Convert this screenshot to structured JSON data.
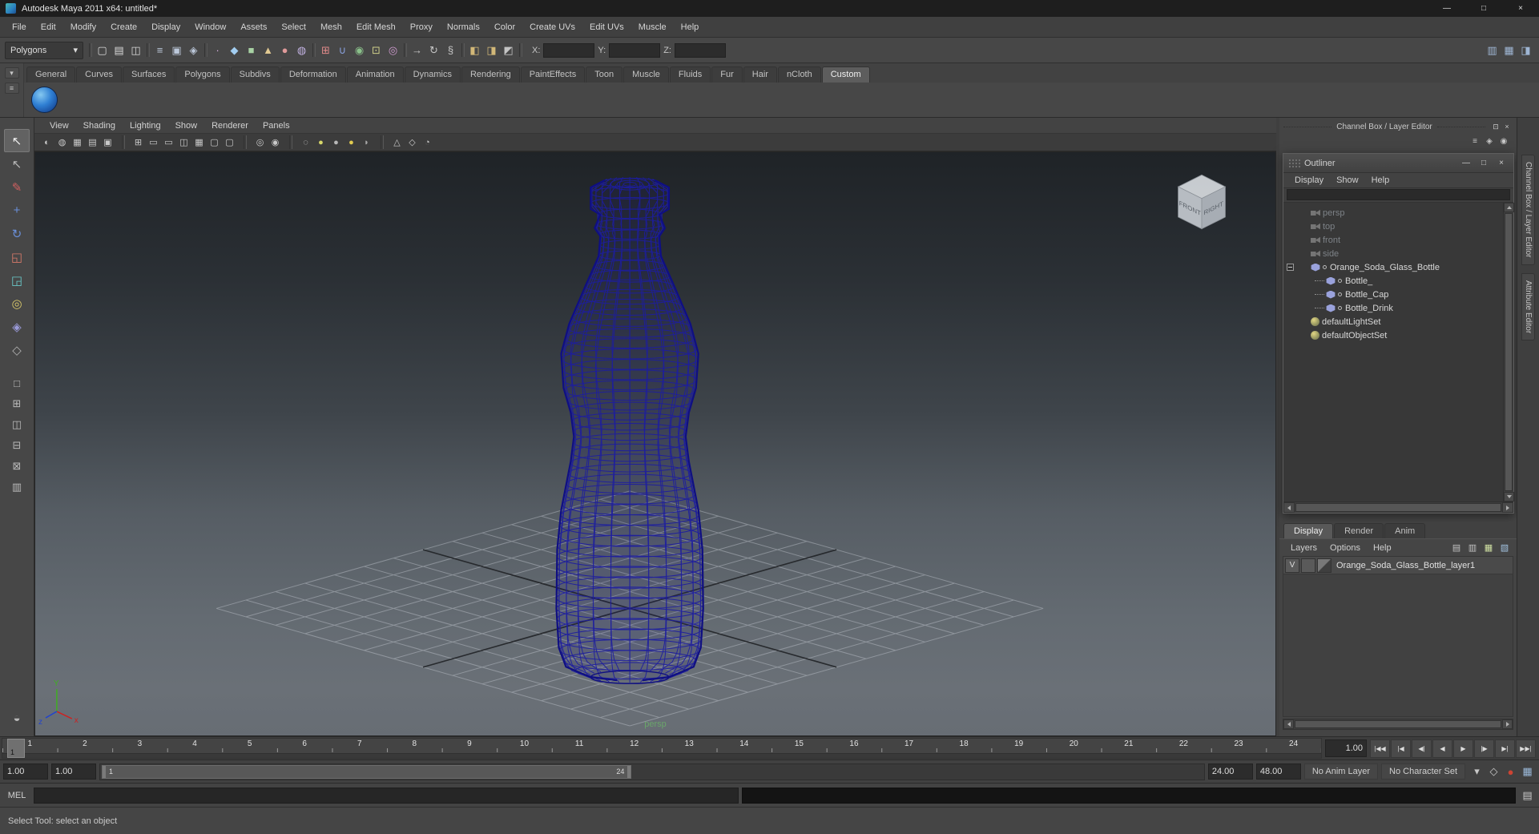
{
  "colors": {
    "wireframe": "#1d1da0",
    "wireframe_dark": "#0f0f82",
    "grid_line": "#c9ced6",
    "grid_axis": "#17191c",
    "axis_x": "#cc2222",
    "axis_y": "#3fae22",
    "axis_z": "#2244cc",
    "camera_label_green": "#6aa66a",
    "autokey_red": "#cc4433",
    "shelf_ball_blue": "#2f7fd3",
    "viewport_top": "#1f2327",
    "viewport_bottom": "#6a7077"
  },
  "window": {
    "title": "Autodesk Maya 2011 x64: untitled*",
    "minimize": "—",
    "maximize": "□",
    "close": "×"
  },
  "menubar": {
    "items": [
      "File",
      "Edit",
      "Modify",
      "Create",
      "Display",
      "Window",
      "Assets",
      "Select",
      "Mesh",
      "Edit Mesh",
      "Proxy",
      "Normals",
      "Color",
      "Create UVs",
      "Edit UVs",
      "Muscle",
      "Help"
    ]
  },
  "statusline": {
    "menuset": "Polygons",
    "dropdown_arrow": "▾",
    "icons": [
      {
        "sep": true
      },
      {
        "name": "new-scene-icon",
        "glyph": "▢",
        "color": "#d8d8d8"
      },
      {
        "name": "open-scene-icon",
        "glyph": "▤",
        "color": "#d8d8d8"
      },
      {
        "name": "save-scene-icon",
        "glyph": "◫",
        "color": "#d8d8d8"
      },
      {
        "sep": true
      },
      {
        "name": "select-hierarchy-icon",
        "glyph": "≡",
        "color": "#bcc8da"
      },
      {
        "name": "select-object-icon",
        "glyph": "▣",
        "color": "#bcc8da"
      },
      {
        "name": "select-component-icon",
        "glyph": "◈",
        "color": "#bcc8da"
      },
      {
        "sep": true
      },
      {
        "name": "mask-points-icon",
        "glyph": "∙",
        "color": "#d8b2e0"
      },
      {
        "name": "mask-curves-icon",
        "glyph": "◆",
        "color": "#a2cdf0"
      },
      {
        "name": "mask-surfaces-icon",
        "glyph": "■",
        "color": "#a8d2a4"
      },
      {
        "name": "mask-deformers-icon",
        "glyph": "▲",
        "color": "#e2ca92"
      },
      {
        "name": "mask-dynamics-icon",
        "glyph": "●",
        "color": "#e09a9a"
      },
      {
        "name": "mask-rendering-icon",
        "glyph": "◍",
        "color": "#c2b2e2"
      },
      {
        "sep": true
      },
      {
        "name": "snap-grid-icon",
        "glyph": "⊞",
        "color": "#e08a8a"
      },
      {
        "name": "snap-curve-icon",
        "glyph": "∪",
        "color": "#8aa2e0"
      },
      {
        "name": "snap-point-icon",
        "glyph": "◉",
        "color": "#8ac08a"
      },
      {
        "name": "snap-view-icon",
        "glyph": "⊡",
        "color": "#cfcf8a"
      },
      {
        "name": "snap-surface-icon",
        "glyph": "◎",
        "color": "#cf9acf"
      },
      {
        "sep": true
      },
      {
        "name": "input-connections-icon",
        "glyph": "→",
        "color": "#c4c4c4"
      },
      {
        "name": "output-connections-icon",
        "glyph": "↻",
        "color": "#c4c4c4"
      },
      {
        "name": "construction-history-icon",
        "glyph": "§",
        "color": "#c4c4c4"
      },
      {
        "sep": true
      },
      {
        "name": "render-current-frame-icon",
        "glyph": "◧",
        "color": "#d2b878"
      },
      {
        "name": "ipr-render-icon",
        "glyph": "◨",
        "color": "#d2b878"
      },
      {
        "name": "render-settings-icon",
        "glyph": "◩",
        "color": "#c4c4c4"
      },
      {
        "sep": true
      }
    ],
    "coord": {
      "x_label": "X:",
      "x_value": "",
      "y_label": "Y:",
      "y_value": "",
      "z_label": "Z:",
      "z_value": ""
    },
    "right_icons": [
      {
        "name": "sidebar-toggle-icon",
        "glyph": "▥"
      },
      {
        "name": "panel-toggle-icon",
        "glyph": "▦"
      },
      {
        "name": "ui-elements-toggle-icon",
        "glyph": "◨"
      }
    ]
  },
  "shelf": {
    "side_buttons": [
      {
        "name": "shelf-tab-selector-icon",
        "glyph": "▾"
      },
      {
        "name": "shelf-menu-icon",
        "glyph": "≡"
      }
    ],
    "tabs": [
      {
        "label": "General"
      },
      {
        "label": "Curves"
      },
      {
        "label": "Surfaces"
      },
      {
        "label": "Polygons"
      },
      {
        "label": "Subdivs"
      },
      {
        "label": "Deformation"
      },
      {
        "label": "Animation"
      },
      {
        "label": "Dynamics"
      },
      {
        "label": "Rendering"
      },
      {
        "label": "PaintEffects"
      },
      {
        "label": "Toon"
      },
      {
        "label": "Muscle"
      },
      {
        "label": "Fluids"
      },
      {
        "label": "Fur"
      },
      {
        "label": "Hair"
      },
      {
        "label": "nCloth"
      },
      {
        "label": "Custom",
        "active": true
      }
    ]
  },
  "toolbox": {
    "tools": [
      {
        "name": "select-tool",
        "glyph": "↖",
        "color": "#efefef",
        "active": true
      },
      {
        "name": "lasso-select-tool",
        "glyph": "↖",
        "color": "#b8b8b8"
      },
      {
        "name": "paint-select-tool",
        "glyph": "✎",
        "color": "#d06060"
      },
      {
        "name": "move-tool",
        "glyph": "+",
        "color": "#6a8fd8"
      },
      {
        "name": "rotate-tool",
        "glyph": "↻",
        "color": "#6a8fd8"
      },
      {
        "name": "scale-tool",
        "glyph": "◱",
        "color": "#d87a6a"
      },
      {
        "name": "universal-manipulator-tool",
        "glyph": "◲",
        "color": "#6ac8c8"
      },
      {
        "name": "soft-mod-tool",
        "glyph": "◎",
        "color": "#d8c86a"
      },
      {
        "name": "show-manipulator-tool",
        "glyph": "◈",
        "color": "#9a9ad8"
      },
      {
        "name": "last-tool",
        "glyph": "◇",
        "color": "#b0b0b0"
      }
    ],
    "layouts": [
      {
        "name": "single-pane-layout-button",
        "glyph": "□"
      },
      {
        "name": "four-pane-layout-button",
        "glyph": "⊞"
      },
      {
        "name": "pane-outliner-layout-button",
        "glyph": "◫"
      },
      {
        "name": "pane-split-layout-button",
        "glyph": "⊟"
      },
      {
        "name": "pane-hypershade-layout-button",
        "glyph": "⊠"
      },
      {
        "name": "pane-custom-layout-button",
        "glyph": "▥"
      }
    ],
    "footer": [
      {
        "name": "tool-settings-icon",
        "glyph": "◒"
      }
    ]
  },
  "panel": {
    "menus": [
      "View",
      "Shading",
      "Lighting",
      "Show",
      "Renderer",
      "Panels"
    ],
    "toolbar_icons": [
      {
        "name": "select-camera-icon",
        "glyph": "◐",
        "color": "#c8c8c8"
      },
      {
        "name": "lock-camera-icon",
        "glyph": "◍",
        "color": "#c8c8c8"
      },
      {
        "name": "camera-attributes-icon",
        "glyph": "▦",
        "color": "#c8c8c8"
      },
      {
        "name": "bookmarks-icon",
        "glyph": "▤",
        "color": "#c8c8c8"
      },
      {
        "name": "image-plane-icon",
        "glyph": "▣",
        "color": "#c8c8c8"
      },
      {
        "sep": true
      },
      {
        "name": "grid-toggle-icon",
        "glyph": "⊞",
        "color": "#c8c8c8"
      },
      {
        "name": "film-gate-icon",
        "glyph": "▭",
        "color": "#c8c8c8"
      },
      {
        "name": "resolution-gate-icon",
        "glyph": "▭",
        "color": "#c8c8c8"
      },
      {
        "name": "gate-mask-icon",
        "glyph": "◫",
        "color": "#c8c8c8"
      },
      {
        "name": "field-chart-icon",
        "glyph": "▦",
        "color": "#c8c8c8"
      },
      {
        "name": "safe-action-icon",
        "glyph": "▢",
        "color": "#c8c8c8"
      },
      {
        "name": "safe-title-icon",
        "glyph": "▢",
        "color": "#c8c8c8"
      },
      {
        "sep": true
      },
      {
        "name": "frame-all-icon",
        "glyph": "◎",
        "color": "#c8c8c8"
      },
      {
        "name": "frame-selection-icon",
        "glyph": "◉",
        "color": "#c8c8c8"
      },
      {
        "sep": true
      },
      {
        "name": "wireframe-display-icon",
        "glyph": "◌",
        "color": "#d0d0d0"
      },
      {
        "name": "shaded-display-icon",
        "glyph": "●",
        "color": "#d8d86a"
      },
      {
        "name": "textured-display-icon",
        "glyph": "●",
        "color": "#b8b8b8"
      },
      {
        "name": "use-all-lights-icon",
        "glyph": "●",
        "color": "#e2cc50"
      },
      {
        "name": "shadows-icon",
        "glyph": "◗",
        "color": "#a8a8a8"
      },
      {
        "sep": true
      },
      {
        "name": "isolate-select-icon",
        "glyph": "△",
        "color": "#c8c8c8"
      },
      {
        "name": "xray-icon",
        "glyph": "◇",
        "color": "#c8c8c8"
      },
      {
        "name": "exposure-icon",
        "glyph": "◔",
        "color": "#c8c8c8"
      }
    ],
    "camera_label": "persp",
    "viewcube": {
      "front": "FRONT",
      "right": "RIGHT"
    },
    "axis": {
      "x": "x",
      "y": "Y",
      "z": "z"
    }
  },
  "outliner": {
    "title": "Outliner",
    "window_buttons": {
      "minimize": "—",
      "maximize": "□",
      "close": "×"
    },
    "menus": [
      "Display",
      "Show",
      "Help"
    ],
    "filter_value": "",
    "items": [
      {
        "label": "persp",
        "camera": true,
        "muted": true
      },
      {
        "label": "top",
        "camera": true,
        "muted": true
      },
      {
        "label": "front",
        "camera": true,
        "muted": true
      },
      {
        "label": "side",
        "camera": true,
        "muted": true
      },
      {
        "label": "Orange_Soda_Glass_Bottle",
        "mesh": true,
        "expand": true,
        "dot": true
      },
      {
        "label": "Bottle_",
        "mesh": true,
        "child": true,
        "dot": true
      },
      {
        "label": "Bottle_Cap",
        "mesh": true,
        "child": true,
        "dot": true
      },
      {
        "label": "Bottle_Drink",
        "mesh": true,
        "child": true,
        "dot": true
      },
      {
        "label": "defaultLightSet",
        "set": true
      },
      {
        "label": "defaultObjectSet",
        "set": true
      }
    ]
  },
  "channelbox": {
    "header": "Channel Box / Layer Editor",
    "header_icons": [
      {
        "name": "float-panel-icon",
        "glyph": "⊡"
      },
      {
        "name": "close-panel-icon",
        "glyph": "×"
      }
    ],
    "side_icons": [
      {
        "name": "channel-speed-icon",
        "glyph": "≡"
      },
      {
        "name": "channel-manip-icon",
        "glyph": "◈"
      },
      {
        "name": "channel-pin-icon",
        "glyph": "◉"
      }
    ],
    "tabs": [
      {
        "label": "Display",
        "active": true
      },
      {
        "label": "Render"
      },
      {
        "label": "Anim"
      }
    ],
    "menus": [
      "Layers",
      "Options",
      "Help"
    ],
    "menu_icons": [
      {
        "name": "layers-normal-icon",
        "glyph": "▤",
        "color": "#c2c2c2"
      },
      {
        "name": "layers-sort-icon",
        "glyph": "▥",
        "color": "#c2c2c2"
      },
      {
        "name": "new-empty-layer-icon",
        "glyph": "▦",
        "color": "#cfe0a2"
      },
      {
        "name": "new-layer-from-selected-icon",
        "glyph": "▧",
        "color": "#a2c2e0"
      }
    ],
    "layers": [
      {
        "visibility": "V",
        "name": "Orange_Soda_Glass_Bottle_layer1"
      }
    ]
  },
  "right_tabs": [
    {
      "label": "Channel Box / Layer Editor"
    },
    {
      "label": "Attribute Editor"
    }
  ],
  "timeline": {
    "frames": [
      "1",
      "2",
      "3",
      "4",
      "5",
      "6",
      "7",
      "8",
      "9",
      "10",
      "11",
      "12",
      "13",
      "14",
      "15",
      "16",
      "17",
      "18",
      "19",
      "20",
      "21",
      "22",
      "23",
      "24"
    ],
    "current": "1",
    "current_time": "1.00",
    "playback_buttons": [
      {
        "name": "go-to-start-button",
        "glyph": "|◀◀"
      },
      {
        "name": "step-back-frame-button",
        "glyph": "|◀"
      },
      {
        "name": "step-back-key-button",
        "glyph": "◀|"
      },
      {
        "name": "play-backwards-button",
        "glyph": "◀"
      },
      {
        "name": "play-forwards-button",
        "glyph": "▶"
      },
      {
        "name": "step-forward-key-button",
        "glyph": "|▶"
      },
      {
        "name": "step-forward-frame-button",
        "glyph": "▶|"
      },
      {
        "name": "go-to-end-button",
        "glyph": "▶▶|"
      }
    ]
  },
  "rangeslider": {
    "anim_start": "1.00",
    "play_start": "1.00",
    "range_start": "1",
    "range_end": "24",
    "play_end": "24.00",
    "anim_end": "48.00",
    "anim_layer": "No Anim Layer",
    "character_set": "No Character Set",
    "icons": [
      {
        "name": "anim-layer-filter-icon",
        "glyph": "▾",
        "color": "#c8c8c8"
      },
      {
        "name": "mute-anim-icon",
        "glyph": "◇",
        "color": "#c8c8c8"
      },
      {
        "name": "auto-keyframe-button",
        "glyph": "●",
        "color": "#cc4433"
      },
      {
        "name": "animation-preferences-icon",
        "glyph": "▦",
        "color": "#9ab8d8"
      }
    ]
  },
  "command_line": {
    "label": "MEL",
    "input_value": ""
  },
  "help_line": {
    "text": "Select Tool: select an object"
  }
}
